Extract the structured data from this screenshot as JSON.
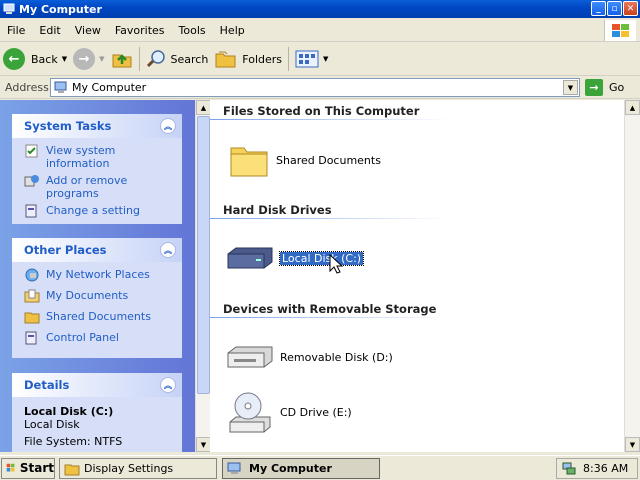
{
  "window": {
    "title": "My Computer"
  },
  "menu": [
    "File",
    "Edit",
    "View",
    "Favorites",
    "Tools",
    "Help"
  ],
  "toolbar": {
    "back": "Back",
    "search": "Search",
    "folders": "Folders"
  },
  "address": {
    "label": "Address",
    "value": "My Computer",
    "go": "Go"
  },
  "left": {
    "system_tasks": {
      "title": "System Tasks",
      "items": [
        "View system information",
        "Add or remove programs",
        "Change a setting"
      ]
    },
    "other_places": {
      "title": "Other Places",
      "items": [
        "My Network Places",
        "My Documents",
        "Shared Documents",
        "Control Panel"
      ]
    },
    "details": {
      "title": "Details",
      "name": "Local Disk (C:)",
      "type": "Local Disk",
      "fs": "File System: NTFS"
    }
  },
  "main": {
    "groups": {
      "stored": "Files Stored on This Computer",
      "hdd": "Hard Disk Drives",
      "removable": "Devices with Removable Storage"
    },
    "items": {
      "shared_docs": "Shared Documents",
      "local_disk": "Local Disk (C:)",
      "removable_disk": "Removable Disk (D:)",
      "cd_drive": "CD Drive (E:)"
    }
  },
  "taskbar": {
    "start": "Start",
    "tasks": [
      "Display Settings",
      "My Computer"
    ],
    "clock": "8:36 AM"
  }
}
